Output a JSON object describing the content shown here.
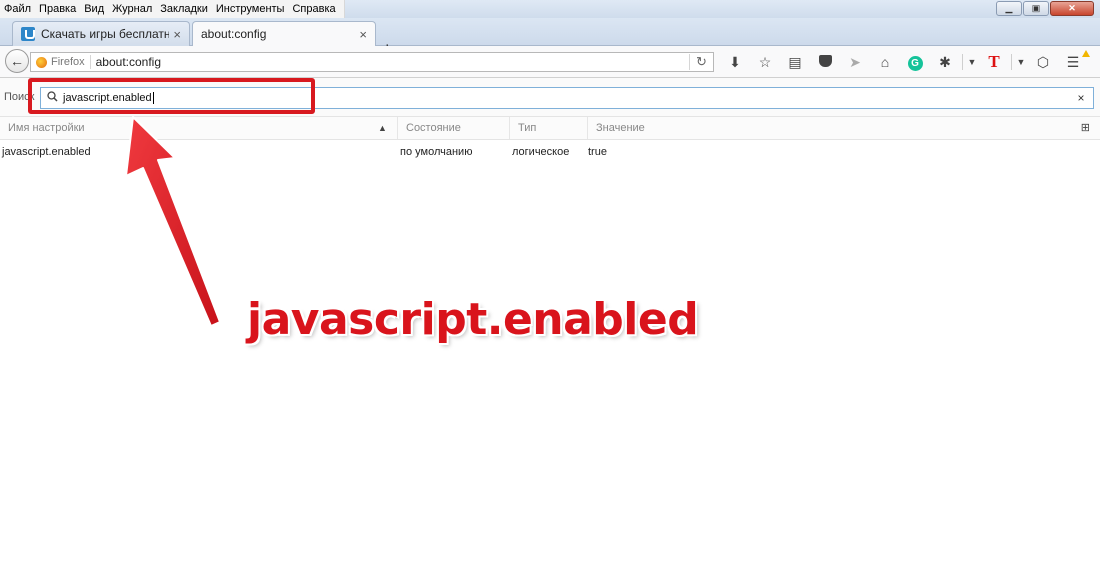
{
  "menu": [
    "Файл",
    "Правка",
    "Вид",
    "Журнал",
    "Закладки",
    "Инструменты",
    "Справка"
  ],
  "window_controls": {
    "minimize": "▁",
    "restore": "▣",
    "close": "✕"
  },
  "tabs": [
    {
      "title": "Скачать игры бесплатно - I",
      "close": "×"
    },
    {
      "title": "about:config",
      "close": "×"
    }
  ],
  "new_tab": "+",
  "navbar": {
    "back": "←",
    "identity_label": "Firefox",
    "url": "about:config",
    "reload": "↻",
    "icons": [
      "download-icon",
      "bookmark-star-icon",
      "reader-icon",
      "pocket-icon",
      "send-icon",
      "home-icon",
      "grammarly-icon",
      "extension-icon",
      "dropdown-icon",
      "translate-t-icon",
      "dropdown-icon",
      "shield-icon",
      "menu-icon"
    ],
    "grammarly_letter": "G",
    "translate_letter": "T"
  },
  "search": {
    "label": "Поиск",
    "value": "javascript.enabled",
    "clear": "×"
  },
  "columns": {
    "name": "Имя настройки",
    "status": "Состояние",
    "type": "Тип",
    "value": "Значение"
  },
  "rows": [
    {
      "name": "javascript.enabled",
      "status": "по умолчанию",
      "type": "логическое",
      "value": "true"
    }
  ],
  "annotation": {
    "text": "javascript.enabled",
    "color": "#d9141c"
  }
}
